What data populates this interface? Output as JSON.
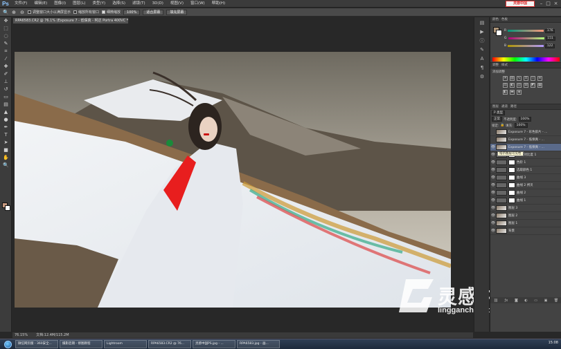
{
  "app": {
    "logo": "Ps"
  },
  "menu": [
    "文件(F)",
    "编辑(E)",
    "图像(I)",
    "图层(L)",
    "类型(Y)",
    "选择(S)",
    "滤镜(T)",
    "3D(D)",
    "视图(V)",
    "窗口(W)",
    "帮助(H)"
  ],
  "brand_badge": "灵感中国",
  "options_bar": {
    "resize_windows": "调整窗口大小以满屏显示",
    "zoom_all": "缩放所有窗口",
    "scrubby_zoom": "细微缩放",
    "btn_100": "100%",
    "btn_fit": "适合屏幕",
    "btn_fill": "填充屏幕"
  },
  "document": {
    "tab": "RPA6583.CR2 @ 76.1% (Exposure 7 - 低保真 - 柯达 Portra 400VC *, RGB/16)"
  },
  "status": {
    "zoom": "76.15%",
    "doc": "文档:12.4M/115.2M"
  },
  "watermark": {
    "cn": "灵感中国",
    "en": "lingganchina.com"
  },
  "panels": {
    "color_tabs": [
      "颜色",
      "色板"
    ],
    "color_values": {
      "r": "176",
      "g": "151",
      "b": "122"
    },
    "adjust_tabs": [
      "调整",
      "样式"
    ],
    "adjust_title": "添加调整",
    "layer_tabs": [
      "图层",
      "通道",
      "路径"
    ],
    "kind_label": "P 类型",
    "blend_mode": "正常",
    "opacity_label": "不透明度:",
    "opacity_value": "100%",
    "lock_label": "锁定:",
    "fill_label": "填充:",
    "fill_value": "100%",
    "tooltip": "指示图层可见性"
  },
  "layers": [
    {
      "name": "Exposure 7 - 彩色胶片 - ...",
      "type": "photo",
      "visible": false,
      "selected": false
    },
    {
      "name": "Exposure 7 - 低保真 - ...",
      "type": "photo",
      "visible": false,
      "selected": false
    },
    {
      "name": "Exposure 7 - 低保真 - ...",
      "type": "photo",
      "visible": true,
      "selected": true
    },
    {
      "name": "亮度/对比度 1",
      "type": "adjust",
      "visible": true,
      "selected": false
    },
    {
      "name": "色阶 1",
      "type": "adjust",
      "visible": true,
      "selected": false
    },
    {
      "name": "选取颜色 1",
      "type": "adjust",
      "visible": true,
      "selected": false
    },
    {
      "name": "曲线 3",
      "type": "adjust",
      "visible": true,
      "selected": false
    },
    {
      "name": "曲线 2 拷贝",
      "type": "adjust",
      "visible": true,
      "selected": false
    },
    {
      "name": "曲线 2",
      "type": "adjust",
      "visible": true,
      "selected": false
    },
    {
      "name": "曲线 1",
      "type": "adjust",
      "visible": true,
      "selected": false
    },
    {
      "name": "图层 3",
      "type": "photo",
      "visible": true,
      "selected": false
    },
    {
      "name": "图层 2",
      "type": "photo",
      "visible": true,
      "selected": false
    },
    {
      "name": "图层 1",
      "type": "photo",
      "visible": true,
      "selected": false
    },
    {
      "name": "背景",
      "type": "photo",
      "visible": true,
      "selected": false
    }
  ],
  "taskbar": {
    "tasks": [
      "微信网页版 - 360安全...",
      "摄影后期 - 修图教程",
      "Lightroom",
      "RPA6583.CR2 @ 76...",
      "灵感中国PS.jpg - ...",
      "RPA6583.jpg - 画..."
    ],
    "clock": "15:08"
  }
}
